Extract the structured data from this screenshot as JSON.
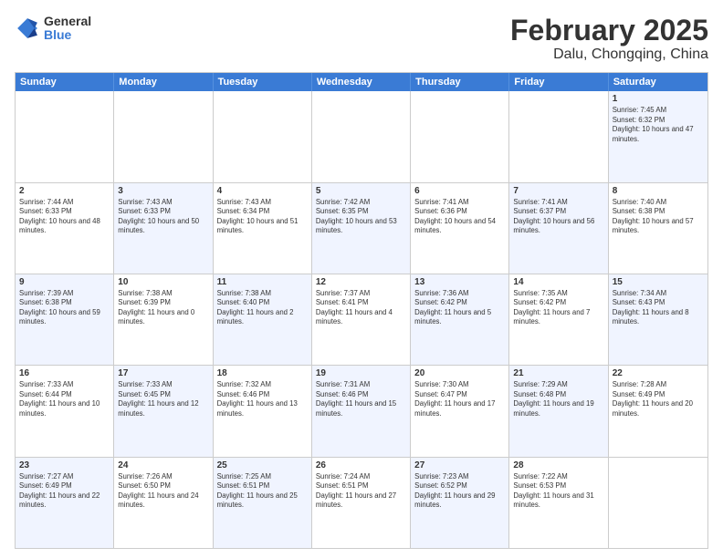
{
  "header": {
    "logo_general": "General",
    "logo_blue": "Blue",
    "month": "February 2025",
    "location": "Dalu, Chongqing, China"
  },
  "weekdays": [
    "Sunday",
    "Monday",
    "Tuesday",
    "Wednesday",
    "Thursday",
    "Friday",
    "Saturday"
  ],
  "rows": [
    [
      {
        "day": "",
        "text": "",
        "empty": true
      },
      {
        "day": "",
        "text": "",
        "empty": true
      },
      {
        "day": "",
        "text": "",
        "empty": true
      },
      {
        "day": "",
        "text": "",
        "empty": true
      },
      {
        "day": "",
        "text": "",
        "empty": true
      },
      {
        "day": "",
        "text": "",
        "empty": true
      },
      {
        "day": "1",
        "text": "Sunrise: 7:45 AM\nSunset: 6:32 PM\nDaylight: 10 hours and 47 minutes.",
        "alt": true
      }
    ],
    [
      {
        "day": "2",
        "text": "Sunrise: 7:44 AM\nSunset: 6:33 PM\nDaylight: 10 hours and 48 minutes.",
        "alt": false
      },
      {
        "day": "3",
        "text": "Sunrise: 7:43 AM\nSunset: 6:33 PM\nDaylight: 10 hours and 50 minutes.",
        "alt": true
      },
      {
        "day": "4",
        "text": "Sunrise: 7:43 AM\nSunset: 6:34 PM\nDaylight: 10 hours and 51 minutes.",
        "alt": false
      },
      {
        "day": "5",
        "text": "Sunrise: 7:42 AM\nSunset: 6:35 PM\nDaylight: 10 hours and 53 minutes.",
        "alt": true
      },
      {
        "day": "6",
        "text": "Sunrise: 7:41 AM\nSunset: 6:36 PM\nDaylight: 10 hours and 54 minutes.",
        "alt": false
      },
      {
        "day": "7",
        "text": "Sunrise: 7:41 AM\nSunset: 6:37 PM\nDaylight: 10 hours and 56 minutes.",
        "alt": true
      },
      {
        "day": "8",
        "text": "Sunrise: 7:40 AM\nSunset: 6:38 PM\nDaylight: 10 hours and 57 minutes.",
        "alt": false
      }
    ],
    [
      {
        "day": "9",
        "text": "Sunrise: 7:39 AM\nSunset: 6:38 PM\nDaylight: 10 hours and 59 minutes.",
        "alt": true
      },
      {
        "day": "10",
        "text": "Sunrise: 7:38 AM\nSunset: 6:39 PM\nDaylight: 11 hours and 0 minutes.",
        "alt": false
      },
      {
        "day": "11",
        "text": "Sunrise: 7:38 AM\nSunset: 6:40 PM\nDaylight: 11 hours and 2 minutes.",
        "alt": true
      },
      {
        "day": "12",
        "text": "Sunrise: 7:37 AM\nSunset: 6:41 PM\nDaylight: 11 hours and 4 minutes.",
        "alt": false
      },
      {
        "day": "13",
        "text": "Sunrise: 7:36 AM\nSunset: 6:42 PM\nDaylight: 11 hours and 5 minutes.",
        "alt": true
      },
      {
        "day": "14",
        "text": "Sunrise: 7:35 AM\nSunset: 6:42 PM\nDaylight: 11 hours and 7 minutes.",
        "alt": false
      },
      {
        "day": "15",
        "text": "Sunrise: 7:34 AM\nSunset: 6:43 PM\nDaylight: 11 hours and 8 minutes.",
        "alt": true
      }
    ],
    [
      {
        "day": "16",
        "text": "Sunrise: 7:33 AM\nSunset: 6:44 PM\nDaylight: 11 hours and 10 minutes.",
        "alt": false
      },
      {
        "day": "17",
        "text": "Sunrise: 7:33 AM\nSunset: 6:45 PM\nDaylight: 11 hours and 12 minutes.",
        "alt": true
      },
      {
        "day": "18",
        "text": "Sunrise: 7:32 AM\nSunset: 6:46 PM\nDaylight: 11 hours and 13 minutes.",
        "alt": false
      },
      {
        "day": "19",
        "text": "Sunrise: 7:31 AM\nSunset: 6:46 PM\nDaylight: 11 hours and 15 minutes.",
        "alt": true
      },
      {
        "day": "20",
        "text": "Sunrise: 7:30 AM\nSunset: 6:47 PM\nDaylight: 11 hours and 17 minutes.",
        "alt": false
      },
      {
        "day": "21",
        "text": "Sunrise: 7:29 AM\nSunset: 6:48 PM\nDaylight: 11 hours and 19 minutes.",
        "alt": true
      },
      {
        "day": "22",
        "text": "Sunrise: 7:28 AM\nSunset: 6:49 PM\nDaylight: 11 hours and 20 minutes.",
        "alt": false
      }
    ],
    [
      {
        "day": "23",
        "text": "Sunrise: 7:27 AM\nSunset: 6:49 PM\nDaylight: 11 hours and 22 minutes.",
        "alt": true
      },
      {
        "day": "24",
        "text": "Sunrise: 7:26 AM\nSunset: 6:50 PM\nDaylight: 11 hours and 24 minutes.",
        "alt": false
      },
      {
        "day": "25",
        "text": "Sunrise: 7:25 AM\nSunset: 6:51 PM\nDaylight: 11 hours and 25 minutes.",
        "alt": true
      },
      {
        "day": "26",
        "text": "Sunrise: 7:24 AM\nSunset: 6:51 PM\nDaylight: 11 hours and 27 minutes.",
        "alt": false
      },
      {
        "day": "27",
        "text": "Sunrise: 7:23 AM\nSunset: 6:52 PM\nDaylight: 11 hours and 29 minutes.",
        "alt": true
      },
      {
        "day": "28",
        "text": "Sunrise: 7:22 AM\nSunset: 6:53 PM\nDaylight: 11 hours and 31 minutes.",
        "alt": false
      },
      {
        "day": "",
        "text": "",
        "empty": true
      }
    ]
  ]
}
